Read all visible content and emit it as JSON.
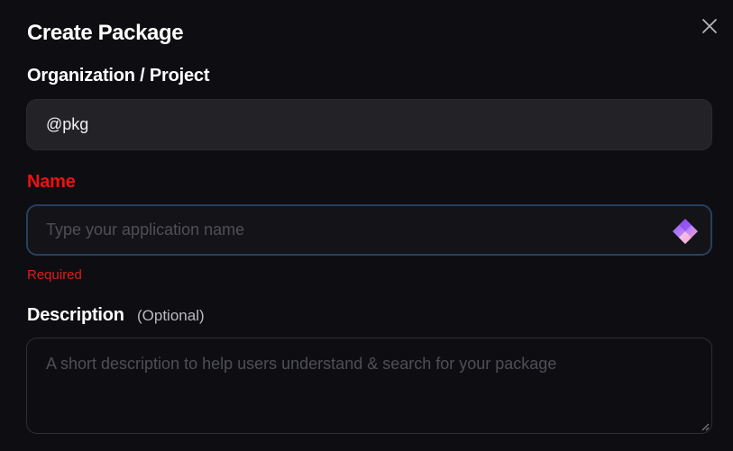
{
  "dialog": {
    "title": "Create Package",
    "close_icon": "close-icon"
  },
  "org_project": {
    "label": "Organization / Project",
    "value": "@pkg"
  },
  "name": {
    "label": "Name",
    "placeholder": "Type your application name",
    "error": "Required",
    "icon": "ai-generate-icon"
  },
  "description": {
    "label": "Description",
    "optional_note": "(Optional)",
    "placeholder": "A short description to help users understand & search for your package"
  },
  "colors": {
    "background": "#0e0e12",
    "error": "#ee1111",
    "focus_border": "#27405c"
  }
}
